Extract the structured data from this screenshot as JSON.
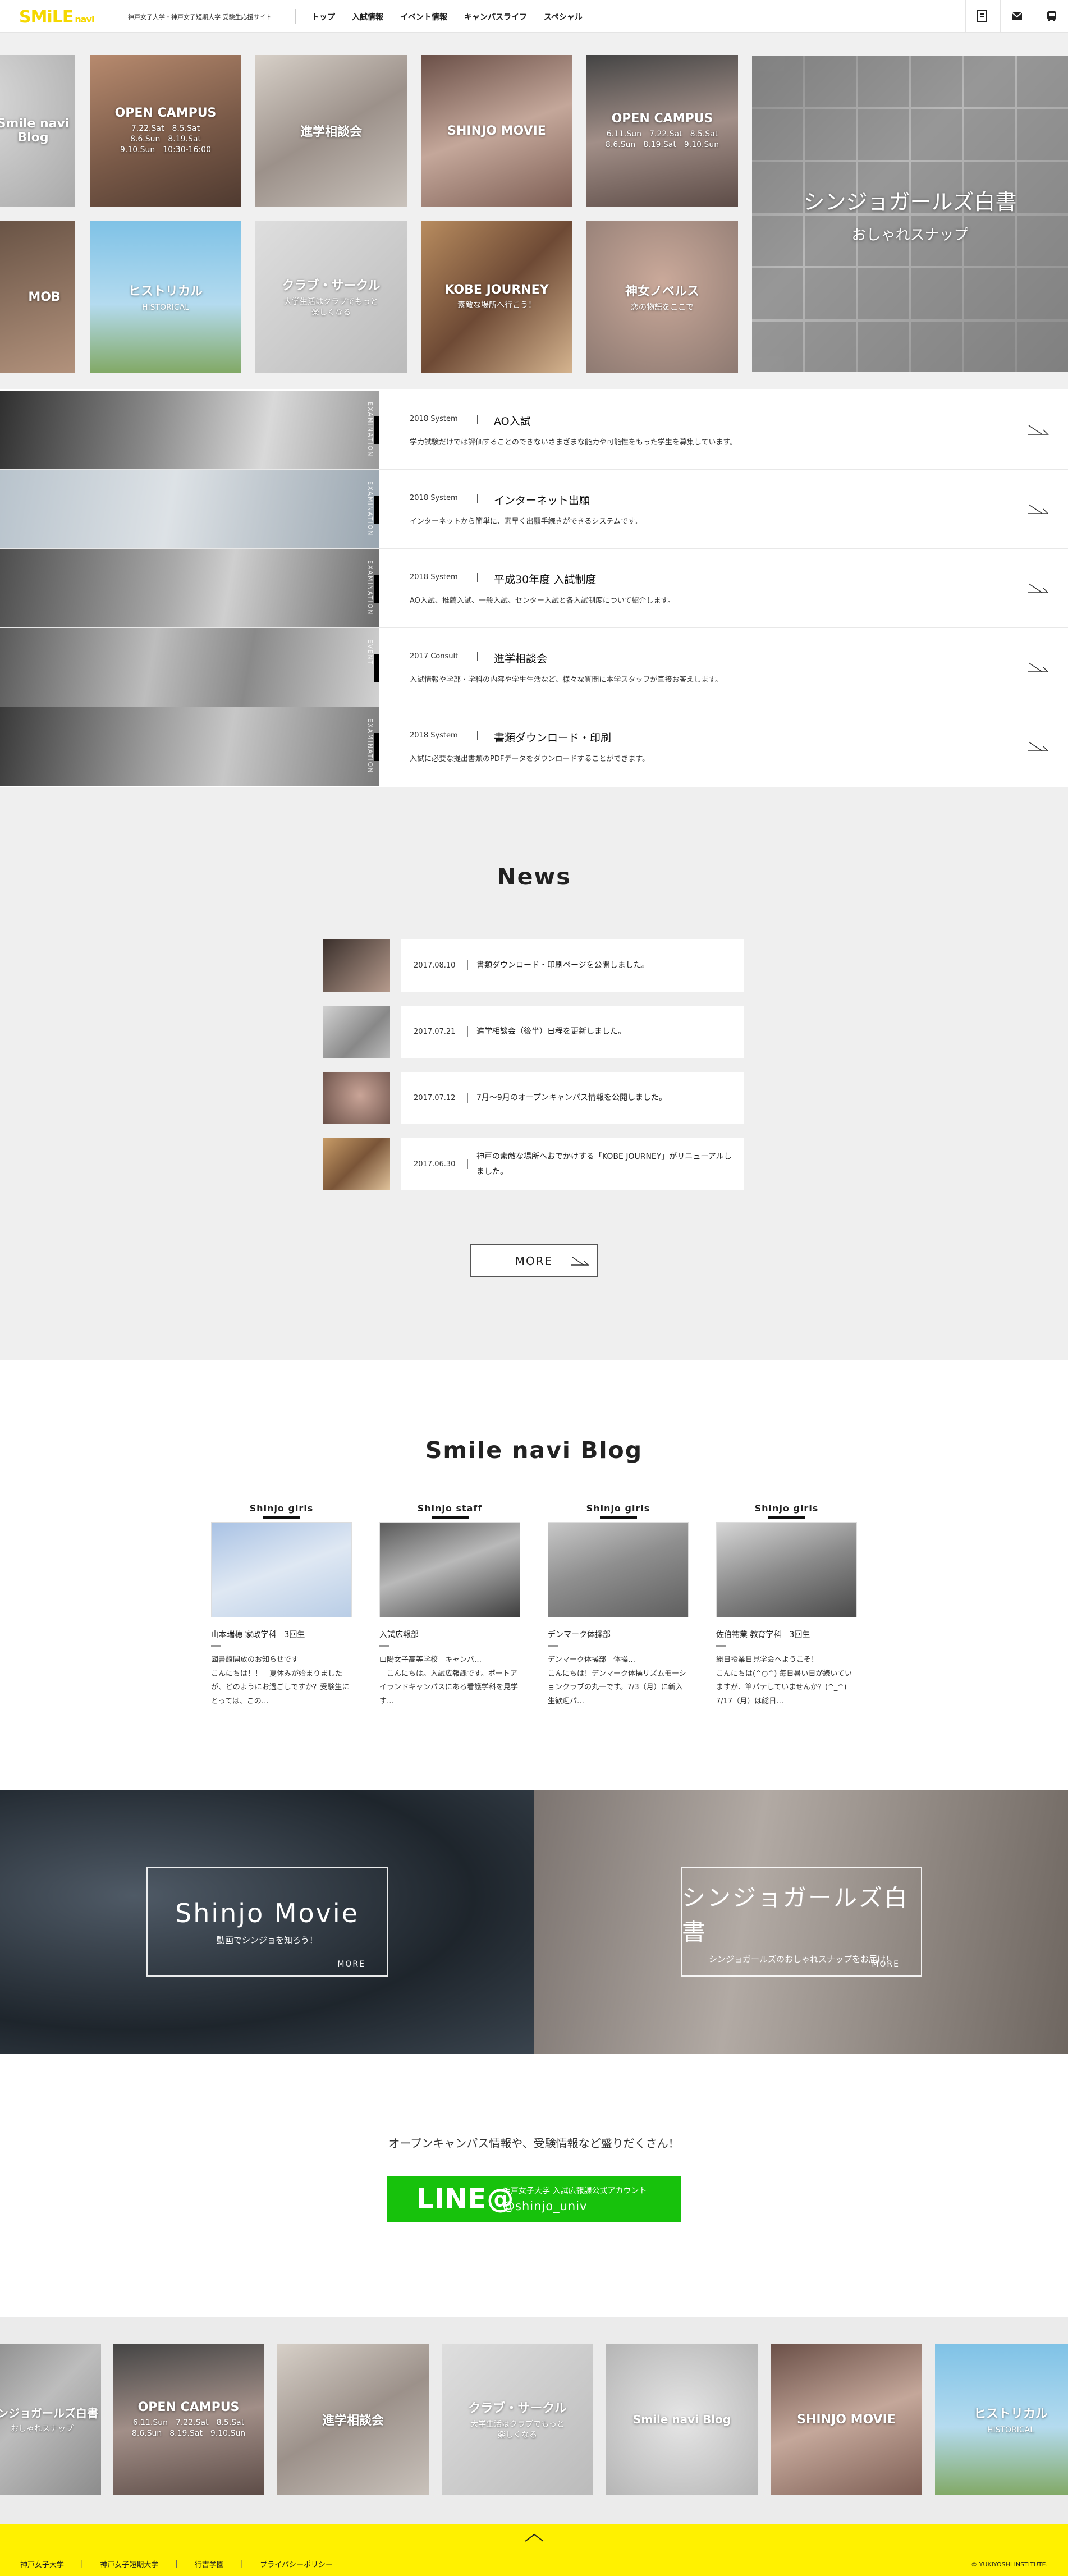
{
  "header": {
    "logo_main": "SMiLE",
    "logo_sub": "navi",
    "tagline": "神戸女子大学・神戸女子短期大学 受験生応援サイト",
    "nav": [
      "トップ",
      "入試情報",
      "イベント情報",
      "キャンパスライフ",
      "スペシャル"
    ],
    "icons": [
      "document-icon",
      "mail-icon",
      "bus-icon"
    ]
  },
  "tiles": {
    "row1": [
      {
        "title": "Smile navi Blog",
        "sub": ""
      },
      {
        "title": "OPEN CAMPUS",
        "sub": "7.22.Sat　8.5.Sat\n8.6.Sun　8.19.Sat\n9.10.Sun　10:30-16:00"
      },
      {
        "title": "進学相談会",
        "sub": ""
      },
      {
        "title": "SHINJO MOVIE",
        "sub": ""
      },
      {
        "title": "OPEN CAMPUS",
        "sub": "6.11.Sun　7.22.Sat　8.5.Sat\n8.6.Sun　8.19.Sat　9.10.Sun"
      }
    ],
    "row2": [
      {
        "title": "MOB",
        "sub": ""
      },
      {
        "title": "ヒストリカル",
        "sub": "HISTORICAL"
      },
      {
        "title": "クラブ・サークル",
        "sub": "大学生活はクラブでもっと\n楽しくなる"
      },
      {
        "title": "KOBE JOURNEY",
        "sub": "素敵な場所へ行こう！"
      },
      {
        "title": "神女ノベルス",
        "sub": "恋の物語をここで"
      }
    ],
    "big": {
      "title": "シンジョガールズ白書",
      "sub": "おしゃれスナップ"
    }
  },
  "system": [
    {
      "meta": "2018 System",
      "title": "AO入試",
      "desc": "学力試験だけでは評価することのできないさまざまな能力や可能性をもった学生を募集しています。",
      "vlabel": "EXAMINATION"
    },
    {
      "meta": "2018 System",
      "title": "インターネット出願",
      "desc": "インターネットから簡単に、素早く出願手続きができるシステムです。",
      "vlabel": "EXAMINATION"
    },
    {
      "meta": "2018 System",
      "title": "平成30年度 入試制度",
      "desc": "AO入試、推薦入試、一般入試、センター入試と各入試制度について紹介します。",
      "vlabel": "EXAMINATION"
    },
    {
      "meta": "2017 Consult",
      "title": "進学相談会",
      "desc": "入試情報や学部・学科の内容や学生生活など、様々な質問に本学スタッフが直接お答えします。",
      "vlabel": "EVENT"
    },
    {
      "meta": "2018 System",
      "title": "書類ダウンロード・印刷",
      "desc": "入試に必要な提出書類のPDFデータをダウンロードすることができます。",
      "vlabel": "EXAMINATION"
    }
  ],
  "news": {
    "title": "News",
    "items": [
      {
        "date": "2017.08.10",
        "text": "書類ダウンロード・印刷ページを公開しました。"
      },
      {
        "date": "2017.07.21",
        "text": "進学相談会（後半）日程を更新しました。"
      },
      {
        "date": "2017.07.12",
        "text": "7月〜9月のオープンキャンパス情報を公開しました。"
      },
      {
        "date": "2017.06.30",
        "text": "神戸の素敵な場所へおでかけする「KOBE JOURNEY」がリニューアルしました。"
      }
    ],
    "more": "MORE"
  },
  "blog": {
    "title": "Smile navi Blog",
    "cards": [
      {
        "category": "Shinjo girls",
        "author": "山本瑞穂  家政学科　3回生",
        "excerpt": "図書館開放のお知らせです\nこんにちは！！　夏休みが始まりましたが、どのようにお過ごしですか？受験生にとっては、この…"
      },
      {
        "category": "Shinjo staff",
        "author": "入試広報部",
        "excerpt": "山陽女子高等学校　キャンパ…\n　こんにちは。入試広報課です。ポートアイランドキャンパスにある看護学科を見学す…"
      },
      {
        "category": "Shinjo girls",
        "author": "デンマーク体操部",
        "excerpt": "デンマーク体操部　体操…\nこんにちは！デンマーク体操リズムモーションクラブの丸一です。7/3（月）に新入生歓迎パ…"
      },
      {
        "category": "Shinjo girls",
        "author": "佐伯祐業  教育学科　3回生",
        "excerpt": "総日授業日見学会へようこそ！\nこんにちは(^○^) 毎日暑い日が続いていますが、筆パテしていませんか？(^_^)　7/17（月）は総日…"
      }
    ]
  },
  "features": [
    {
      "title": "Shinjo Movie",
      "sub": "動画でシンジョを知ろう！",
      "more": "MORE"
    },
    {
      "title": "シンジョガールズ白書",
      "sub": "シンジョガールズのおしゃれスナップをお届け！",
      "more": "MORE"
    }
  ],
  "line": {
    "message": "オープンキャンパス情報や、受験情報など盛りだくさん！",
    "logo": "LINE@",
    "account": "神戸女子大学 入試広報課公式アカウント",
    "handle": "@shinjo_univ"
  },
  "carousel": [
    {
      "title": "シンジョガールズ白書",
      "sub": "おしゃれスナップ"
    },
    {
      "title": "OPEN CAMPUS",
      "sub": "6.11.Sun　7.22.Sat　8.5.Sat\n8.6.Sun　8.19.Sat　9.10.Sun"
    },
    {
      "title": "進学相談会",
      "sub": ""
    },
    {
      "title": "クラブ・サークル",
      "sub": "大学生活はクラブでもっと\n楽しくなる"
    },
    {
      "title": "Smile navi Blog",
      "sub": ""
    },
    {
      "title": "SHINJO MOVIE",
      "sub": ""
    },
    {
      "title": "ヒストリカル",
      "sub": "HISTORICAL"
    }
  ],
  "footer": {
    "links": [
      "神戸女子大学",
      "神戸女子短期大学",
      "行吉学園",
      "プライバシーポリシー"
    ],
    "copyright": "© YUKIYOSHI INSTITUTE.",
    "pagetop_icon": "chevron-up-icon"
  },
  "colors": {
    "brand_yellow": "#fff100",
    "line_green": "#17c20c"
  }
}
